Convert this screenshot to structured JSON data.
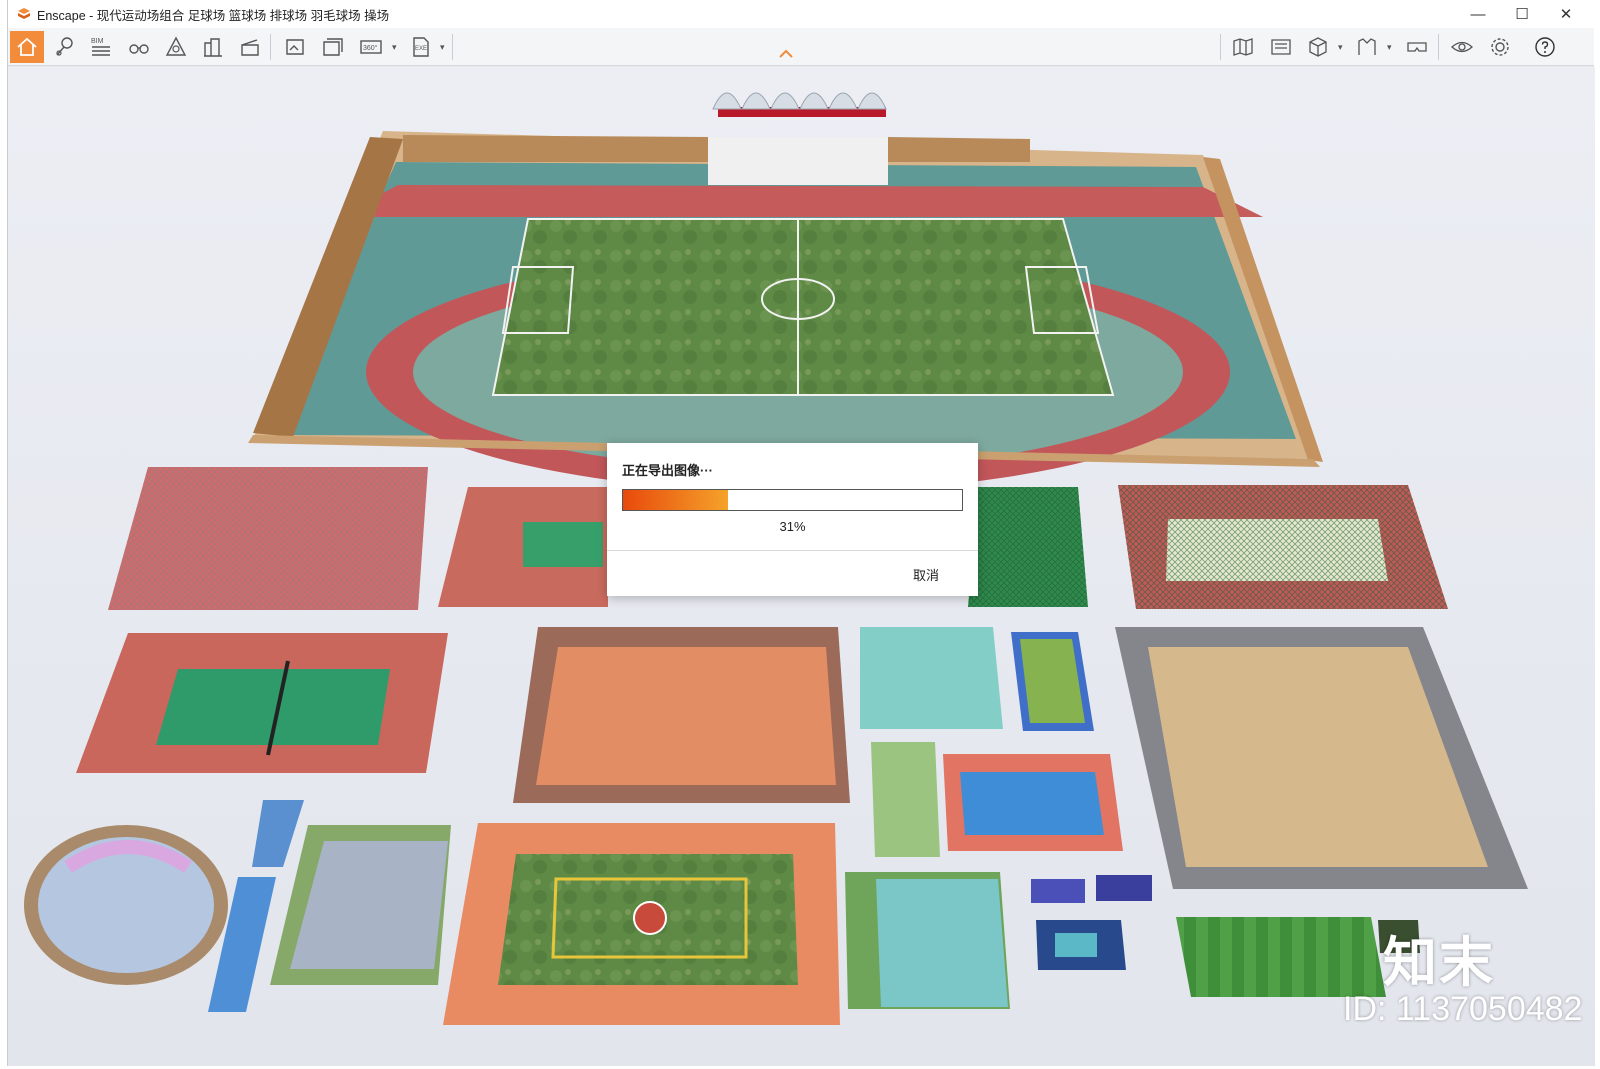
{
  "window": {
    "title": "Enscape - 现代运动场组合 足球场 篮球场 排球场 羽毛球场 操场",
    "controls": {
      "minimize": "—",
      "maximize": "☐",
      "close": "✕"
    }
  },
  "toolbar": {
    "bim_label": "BIM",
    "panorama_label": "360°",
    "exe_label": "EXE",
    "home_color": "#f28b3a"
  },
  "dialog": {
    "title": "正在导出图像···",
    "progress_text": "31%",
    "progress_fraction": 0.31,
    "cancel_label": "取消"
  },
  "watermark": {
    "logo_text": "知末",
    "id_text": "ID: 1137050482"
  }
}
